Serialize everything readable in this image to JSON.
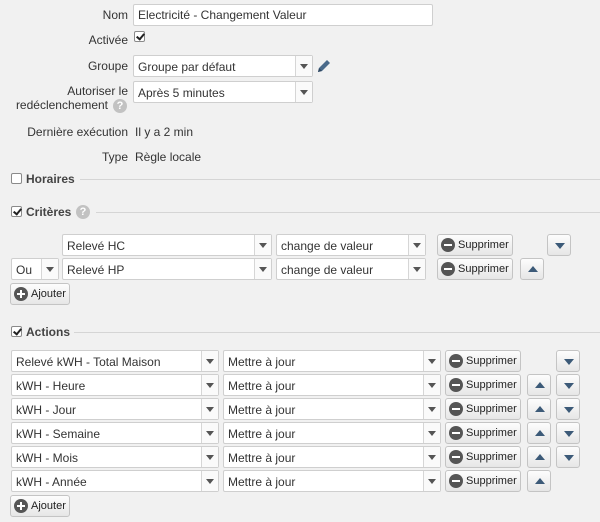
{
  "form": {
    "name_label": "Nom",
    "name_value": "Electricité - Changement Valeur",
    "active_label": "Activée",
    "active_checked": true,
    "group_label": "Groupe",
    "group_value": "Groupe par défaut",
    "retrigger_label_1": "Autoriser le",
    "retrigger_label_2": "redéclenchement",
    "retrigger_value": "Après 5 minutes",
    "last_exec_label": "Dernière exécution",
    "last_exec_value": "Il y a 2 min",
    "type_label": "Type",
    "type_value": "Règle locale"
  },
  "schedules": {
    "title": "Horaires",
    "checked": false
  },
  "criteria": {
    "title": "Critères",
    "checked": true,
    "rows": [
      {
        "operator": "",
        "device": "Relevé HC",
        "condition": "change de valeur"
      },
      {
        "operator": "Ou",
        "device": "Relevé HP",
        "condition": "change de valeur"
      }
    ],
    "delete_label": "Supprimer",
    "add_label": "Ajouter"
  },
  "actions": {
    "title": "Actions",
    "checked": true,
    "rows": [
      {
        "device": "Relevé kWH - Total Maison",
        "action": "Mettre à jour"
      },
      {
        "device": "kWH - Heure",
        "action": "Mettre à jour"
      },
      {
        "device": "kWH - Jour",
        "action": "Mettre à jour"
      },
      {
        "device": "kWH - Semaine",
        "action": "Mettre à jour"
      },
      {
        "device": "kWH - Mois",
        "action": "Mettre à jour"
      },
      {
        "device": "kWH - Année",
        "action": "Mettre à jour"
      }
    ],
    "delete_label": "Supprimer",
    "add_label": "Ajouter"
  },
  "icons": {
    "edit": "pencil-icon",
    "help": "help-icon",
    "help_glyph": "?",
    "remove": "minus-circle-icon",
    "add": "plus-circle-icon",
    "up": "arrow-up-icon",
    "down": "arrow-down-icon"
  }
}
